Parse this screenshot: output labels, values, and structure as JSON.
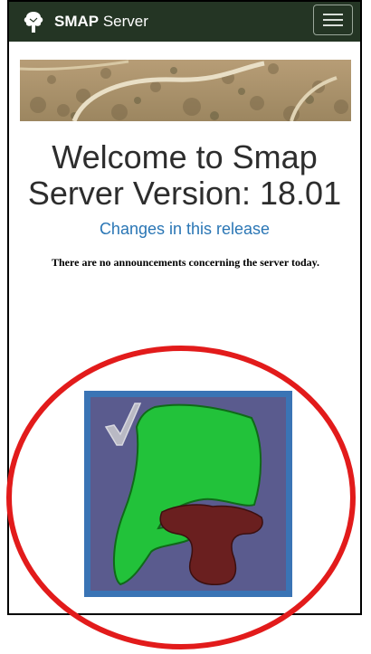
{
  "navbar": {
    "brand_bold": "SMAP",
    "brand_rest": " Server",
    "brand_icon": "tree-icon",
    "menu_icon": "hamburger-icon"
  },
  "main": {
    "title": "Welcome to Smap Server Version: 18.01",
    "changes_link": "Changes in this release",
    "announcement": "There are no announcements concerning the server today."
  },
  "colors": {
    "navbar": "#243524",
    "link": "#2a76b5",
    "highlight_circle": "#e21b1b",
    "logo_frame": "#3a74b5",
    "logo_bg": "#5a5b8e",
    "logo_green": "#22c23a",
    "logo_maroon": "#6a1f1f"
  }
}
